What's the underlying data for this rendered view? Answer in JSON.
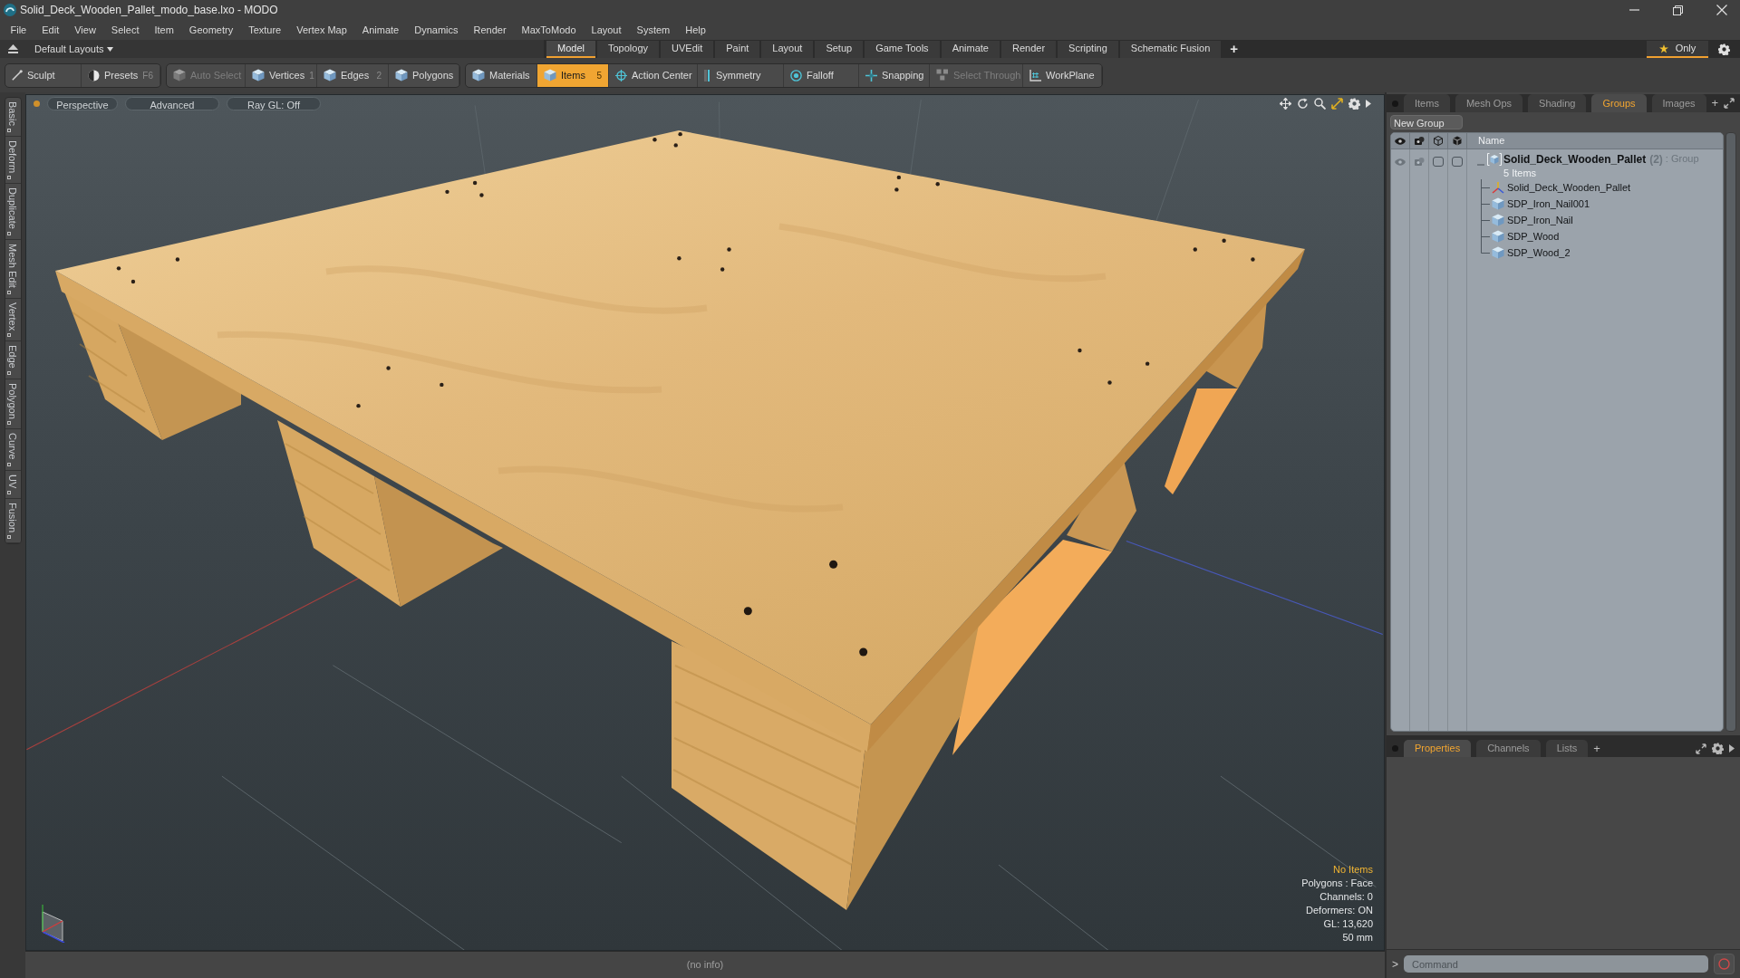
{
  "window": {
    "title": "Solid_Deck_Wooden_Pallet_modo_base.lxo - MODO"
  },
  "menu_bar": [
    "File",
    "Edit",
    "View",
    "Select",
    "Item",
    "Geometry",
    "Texture",
    "Vertex Map",
    "Animate",
    "Dynamics",
    "Render",
    "MaxToModo",
    "Layout",
    "System",
    "Help"
  ],
  "layout_bar": {
    "layout_menu": "Default Layouts",
    "tabs": [
      {
        "label": "Model",
        "selected": true
      },
      {
        "label": "Topology",
        "selected": false
      },
      {
        "label": "UVEdit",
        "selected": false
      },
      {
        "label": "Paint",
        "selected": false
      },
      {
        "label": "Layout",
        "selected": false
      },
      {
        "label": "Setup",
        "selected": false
      },
      {
        "label": "Game Tools",
        "selected": false
      },
      {
        "label": "Animate",
        "selected": false
      },
      {
        "label": "Render",
        "selected": false
      },
      {
        "label": "Scripting",
        "selected": false
      },
      {
        "label": "Schematic Fusion",
        "selected": false
      }
    ],
    "add_tab": "+",
    "only_toggle": {
      "label": "Only",
      "selected": true
    }
  },
  "toolbar": {
    "groups": [
      [
        {
          "kind": "sculpt",
          "label": "Sculpt",
          "selected": false,
          "disabled": false
        },
        {
          "kind": "presets",
          "label": "Presets",
          "shortcut": "F6",
          "selected": false,
          "disabled": false
        }
      ],
      [
        {
          "kind": "autoselect",
          "label": "Auto Select",
          "selected": false,
          "disabled": true
        },
        {
          "kind": "vertices",
          "label": "Vertices",
          "shortcut": "1",
          "selected": false,
          "disabled": false
        },
        {
          "kind": "edges",
          "label": "Edges",
          "shortcut": "2",
          "selected": false,
          "disabled": false
        },
        {
          "kind": "polygons",
          "label": "Polygons",
          "selected": false,
          "disabled": false
        }
      ],
      [
        {
          "kind": "materials",
          "label": "Materials",
          "selected": false,
          "disabled": false
        },
        {
          "kind": "items",
          "label": "Items",
          "shortcut": "5",
          "selected": true,
          "disabled": false
        },
        {
          "kind": "actioncenter",
          "label": "Action Center",
          "selected": false,
          "disabled": false
        },
        {
          "kind": "symmetry",
          "label": "Symmetry",
          "selected": false,
          "disabled": false
        },
        {
          "kind": "falloff",
          "label": "Falloff",
          "selected": false,
          "disabled": false
        },
        {
          "kind": "snapping",
          "label": "Snapping",
          "selected": false,
          "disabled": false
        },
        {
          "kind": "selectthrough",
          "label": "Select Through",
          "selected": false,
          "disabled": true
        },
        {
          "kind": "workplane",
          "label": "WorkPlane",
          "selected": false,
          "disabled": false
        }
      ]
    ]
  },
  "tool_tabs": [
    "Basic",
    "Deform",
    "Duplicate",
    "Mesh Edit",
    "Vertex",
    "Edge",
    "Polygon",
    "Curve",
    "UV",
    "Fusion"
  ],
  "viewport": {
    "buttons": [
      "Perspective",
      "Advanced",
      "Ray GL: Off"
    ],
    "info": {
      "selection": "No Items",
      "lines": [
        "Polygons : Face",
        "Channels: 0",
        "Deformers: ON",
        "GL: 13,620",
        "50 mm"
      ]
    }
  },
  "status_bar": {
    "text": "(no info)"
  },
  "item_panel": {
    "tabs": [
      {
        "label": "Items",
        "selected": false
      },
      {
        "label": "Mesh Ops",
        "selected": false
      },
      {
        "label": "Shading",
        "selected": false
      },
      {
        "label": "Groups",
        "selected": true
      },
      {
        "label": "Images",
        "selected": false
      }
    ],
    "add_tab": "+",
    "new_group_button": "New Group",
    "columns": [
      "Name"
    ],
    "groups": [
      {
        "name": "Solid_Deck_Wooden_Pallet",
        "count": "(2)",
        "type": ": Group",
        "summary": "5 Items",
        "expanded": true,
        "children": [
          {
            "kind": "locator",
            "name": "Solid_Deck_Wooden_Pallet"
          },
          {
            "kind": "mesh",
            "name": "SDP_Iron_Nail001"
          },
          {
            "kind": "mesh",
            "name": "SDP_Iron_Nail"
          },
          {
            "kind": "mesh",
            "name": "SDP_Wood"
          },
          {
            "kind": "mesh",
            "name": "SDP_Wood_2"
          }
        ]
      }
    ]
  },
  "properties_panel": {
    "tabs": [
      {
        "label": "Properties",
        "selected": true
      },
      {
        "label": "Channels",
        "selected": false
      },
      {
        "label": "Lists",
        "selected": false
      }
    ],
    "add_tab": "+",
    "command": {
      "prompt": ">",
      "placeholder": "Command"
    }
  }
}
